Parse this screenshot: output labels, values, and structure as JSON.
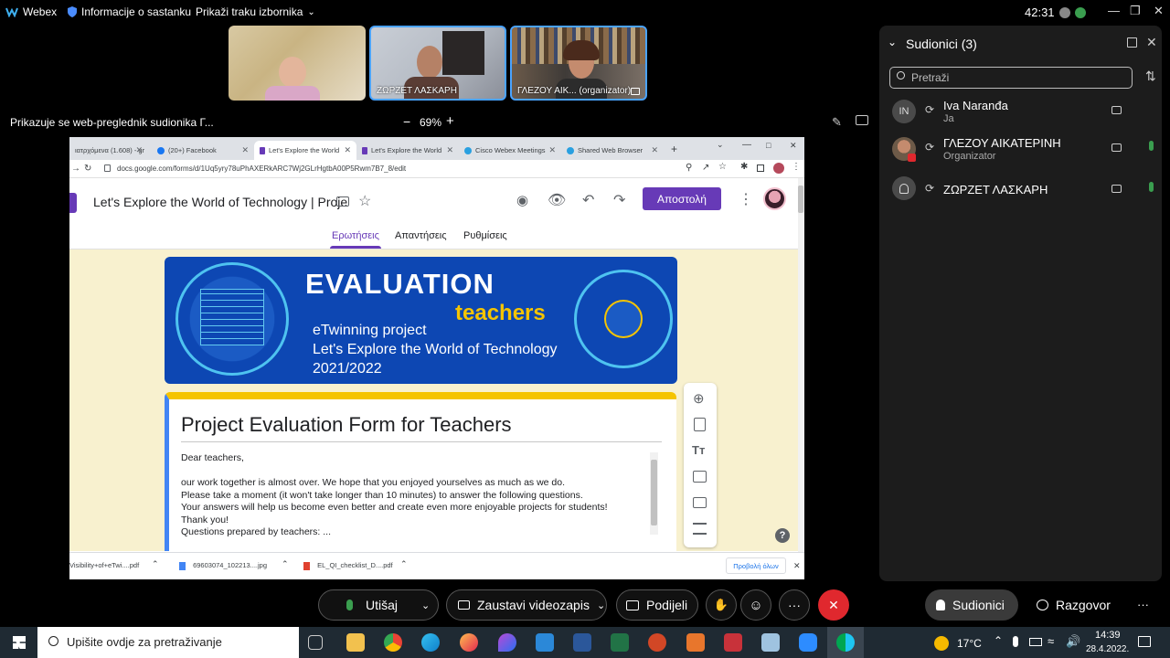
{
  "topbar": {
    "app_name": "Webex",
    "meeting_info": "Informacije o sastanku",
    "show_menu": "Prikaži traku izbornika",
    "timer": "42:31"
  },
  "videos": [
    {
      "name": ""
    },
    {
      "name": "ΖΩΡΖΕΤ ΛΑΣΚΑΡΗ"
    },
    {
      "name": "ΓΛΕΖΟΥ ΑΙΚ... (organizator)"
    }
  ],
  "share_bar": {
    "text": "Prikazuje se web-preglednik sudionika Γ...",
    "zoom_minus": "−",
    "zoom": "69%",
    "zoom_plus": "+"
  },
  "browser": {
    "tabs": [
      {
        "label": "ιατρχόμενα (1.608) - gr"
      },
      {
        "label": "(20+) Facebook"
      },
      {
        "label": "Let's Explore the World"
      },
      {
        "label": "Let's Explore the World"
      },
      {
        "label": "Cisco Webex Meetings"
      },
      {
        "label": "Shared Web Browser"
      }
    ],
    "url": "docs.google.com/forms/d/1Uq5yry78uPhAXERkARC7Wj2GLrHgtbA00P5Rwm7B7_8/edit",
    "form_title": "Let's Explore the World of Technology | Proje",
    "send_button": "Αποστολή",
    "form_tabs": [
      "Ερωτήσεις",
      "Απαντήσεις",
      "Ρυθμίσεις"
    ],
    "banner": {
      "line1": "EVALUATION",
      "line2": "teachers",
      "line3": "eTwinning project",
      "line4": "Let's Explore the World of Technology",
      "line5": "2021/2022"
    },
    "card_title": "Project Evaluation Form for Teachers",
    "description": [
      "Dear teachers,",
      "",
      "our work together is almost over. We hope that you enjoyed yourselves as much as we do.",
      "Please take a moment (it won't take longer than 10 minutes) to answer the following questions.",
      "Your answers will help us become even better and create even more enjoyable projects for students!",
      "Thank you!",
      "Questions prepared by teachers: ..."
    ],
    "help": "?",
    "downloads": [
      {
        "name": "Visibility+of+eTwi....pdf"
      },
      {
        "name": "69603074_102213....jpg"
      },
      {
        "name": "EL_QI_checklist_D....pdf"
      }
    ],
    "show_all": "Προβολή όλων"
  },
  "panel": {
    "title": "Sudionici (3)",
    "search_placeholder": "Pretraži",
    "participants": [
      {
        "initials": "IN",
        "name": "Iva Naranđa",
        "role": "Ja"
      },
      {
        "initials": "",
        "name": "ΓΛΕΖΟΥ ΑΙΚΑΤΕΡΙΝΗ",
        "role": "Organizator"
      },
      {
        "initials": "",
        "name": "ΖΩΡΖΕΤ ΛΑΣΚΑΡΗ",
        "role": ""
      }
    ]
  },
  "controls": {
    "mute": "Utišaj",
    "stop_video": "Zaustavi videozapis",
    "share": "Podijeli",
    "more": "···",
    "participants": "Sudionici",
    "chat": "Razgovor",
    "end_color": "#e0282e"
  },
  "taskbar": {
    "search_placeholder": "Upišite ovdje za pretraživanje",
    "temperature": "17°C",
    "time": "14:39",
    "date": "28.4.2022."
  }
}
